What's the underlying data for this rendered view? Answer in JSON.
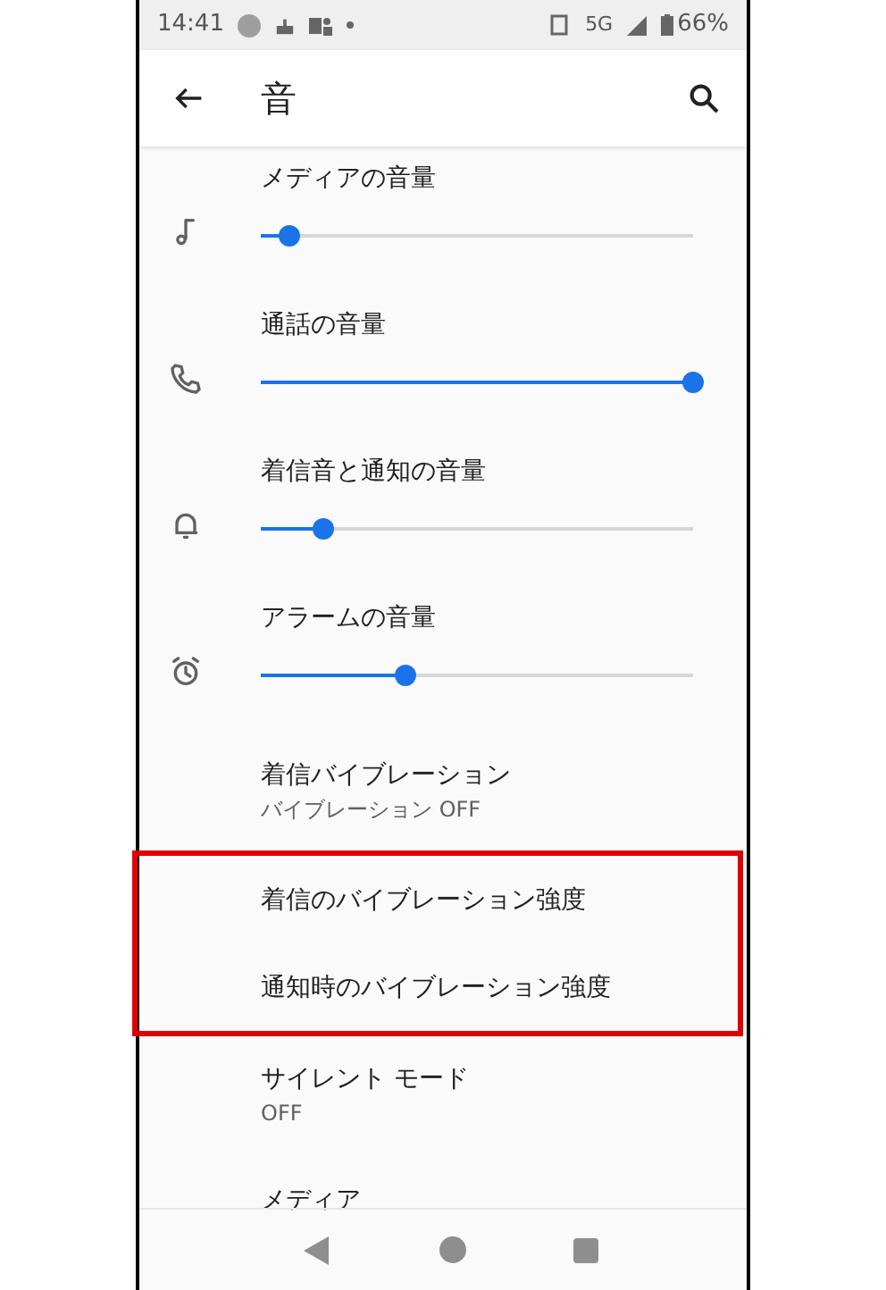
{
  "status_bar": {
    "time": "14:41",
    "network": "5G",
    "battery": "66%"
  },
  "app_bar": {
    "title": "音"
  },
  "volume_sliders": [
    {
      "kind": "music",
      "label": "メディアの音量",
      "level": 0.066
    },
    {
      "kind": "phone",
      "label": "通話の音量",
      "level": 1
    },
    {
      "kind": "bell",
      "label": "着信音と通知の音量",
      "level": 0.145
    },
    {
      "kind": "alarm",
      "label": "アラームの音量",
      "level": 0.335
    }
  ],
  "settings": [
    {
      "title": "着信バイブレーション",
      "summary": "バイブレーション OFF",
      "highlighted": false
    },
    {
      "title": "着信のバイブレーション強度",
      "highlighted": true
    },
    {
      "title": "通知時のバイブレーション強度",
      "highlighted": true
    },
    {
      "title": "サイレント モード",
      "summary": "OFF",
      "highlighted": false
    },
    {
      "title": "メディア",
      "highlighted": false
    }
  ]
}
